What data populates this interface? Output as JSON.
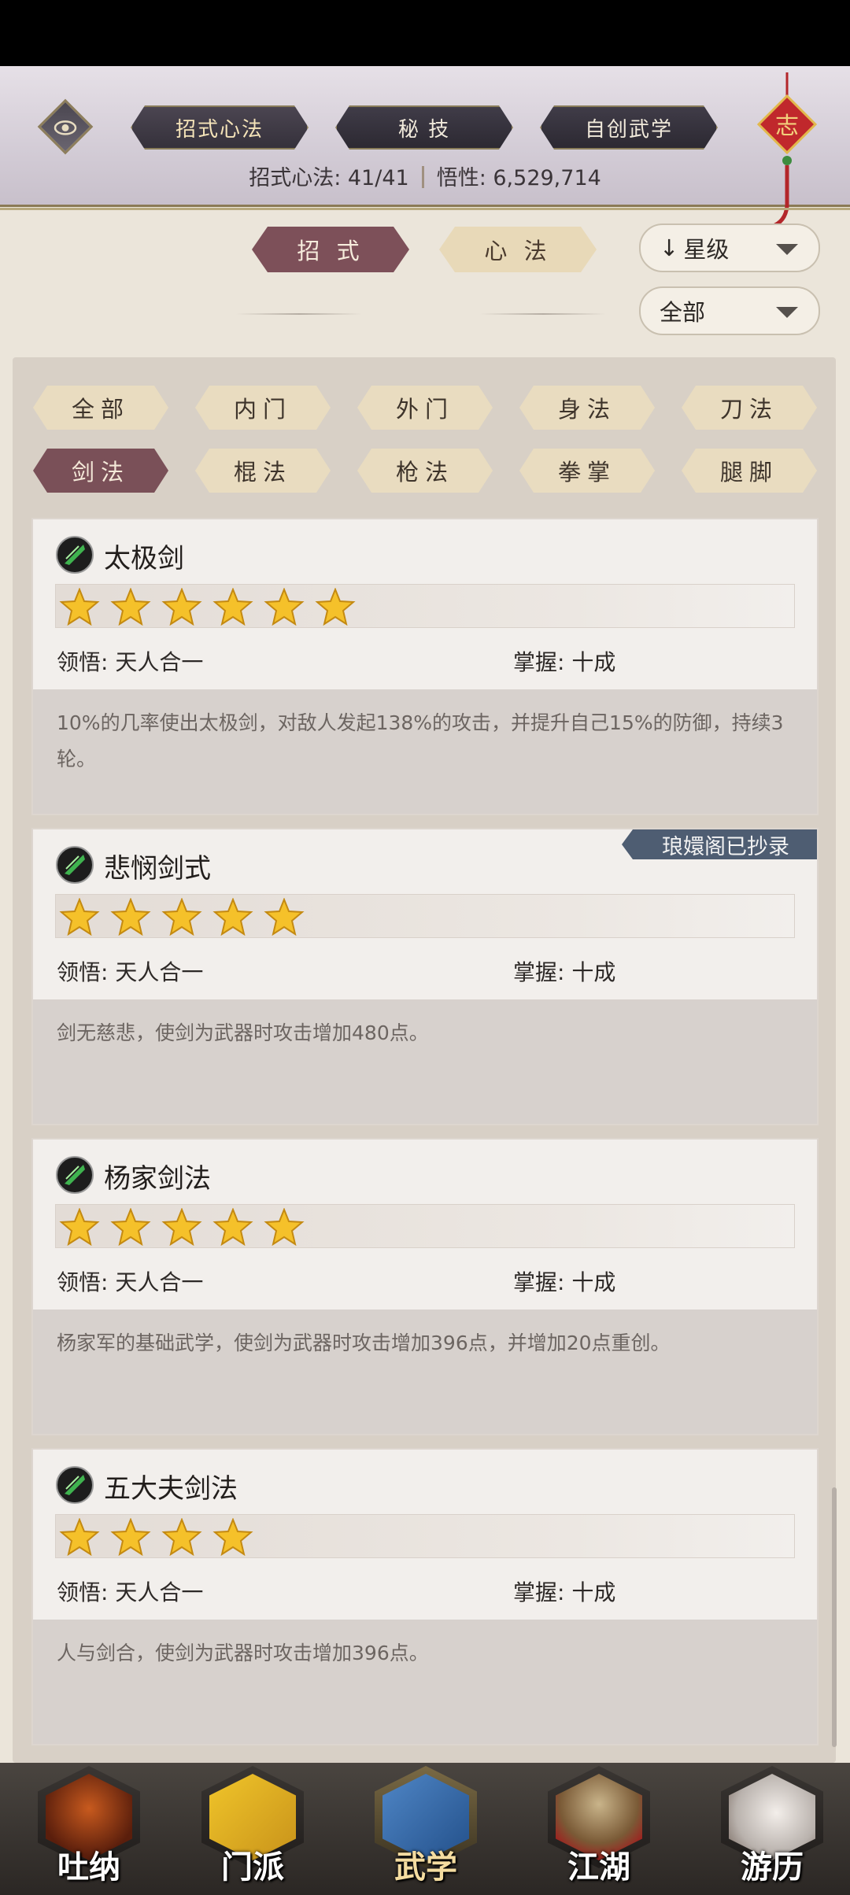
{
  "header": {
    "tabs": [
      {
        "label": "招式心法",
        "active": true
      },
      {
        "label": "秘 技",
        "active": false
      },
      {
        "label": "自创武学",
        "active": false
      }
    ],
    "stats_label": "招式心法: 41/41",
    "insight_label": "悟性: 6,529,714",
    "talisman_char": "志"
  },
  "filters": {
    "segment_moves": "招 式",
    "segment_mind": "心 法",
    "sort_label": "星级",
    "scope_label": "全部"
  },
  "categories": [
    "全部",
    "内门",
    "外门",
    "身法",
    "刀法",
    "剑法",
    "棍法",
    "枪法",
    "拳掌",
    "腿脚"
  ],
  "active_category": "剑法",
  "skills": [
    {
      "name": "太极剑",
      "stars": 6,
      "comprehension": "领悟: 天人合一",
      "mastery": "掌握: 十成",
      "desc": "10%的几率使出太极剑，对敌人发起138%的攻击，并提升自己15%的防御，持续3轮。",
      "badge": ""
    },
    {
      "name": "悲悯剑式",
      "stars": 5,
      "comprehension": "领悟: 天人合一",
      "mastery": "掌握: 十成",
      "desc": "剑无慈悲，使剑为武器时攻击增加480点。",
      "badge": "琅嬛阁已抄录"
    },
    {
      "name": "杨家剑法",
      "stars": 5,
      "comprehension": "领悟: 天人合一",
      "mastery": "掌握: 十成",
      "desc": "杨家军的基础武学，使剑为武器时攻击增加396点，并增加20点重创。",
      "badge": ""
    },
    {
      "name": "五大夫剑法",
      "stars": 4,
      "comprehension": "领悟: 天人合一",
      "mastery": "掌握: 十成",
      "desc": "人与剑合，使剑为武器时攻击增加396点。",
      "badge": ""
    }
  ],
  "nav": [
    {
      "label": "吐纳",
      "active": false
    },
    {
      "label": "门派",
      "active": false
    },
    {
      "label": "武学",
      "active": true
    },
    {
      "label": "江湖",
      "active": false
    },
    {
      "label": "游历",
      "active": false
    }
  ],
  "colors": {
    "accent": "#7d5059",
    "chip": "#e9dcc0",
    "badge": "#4e5d72",
    "star": "#f5c12a"
  }
}
